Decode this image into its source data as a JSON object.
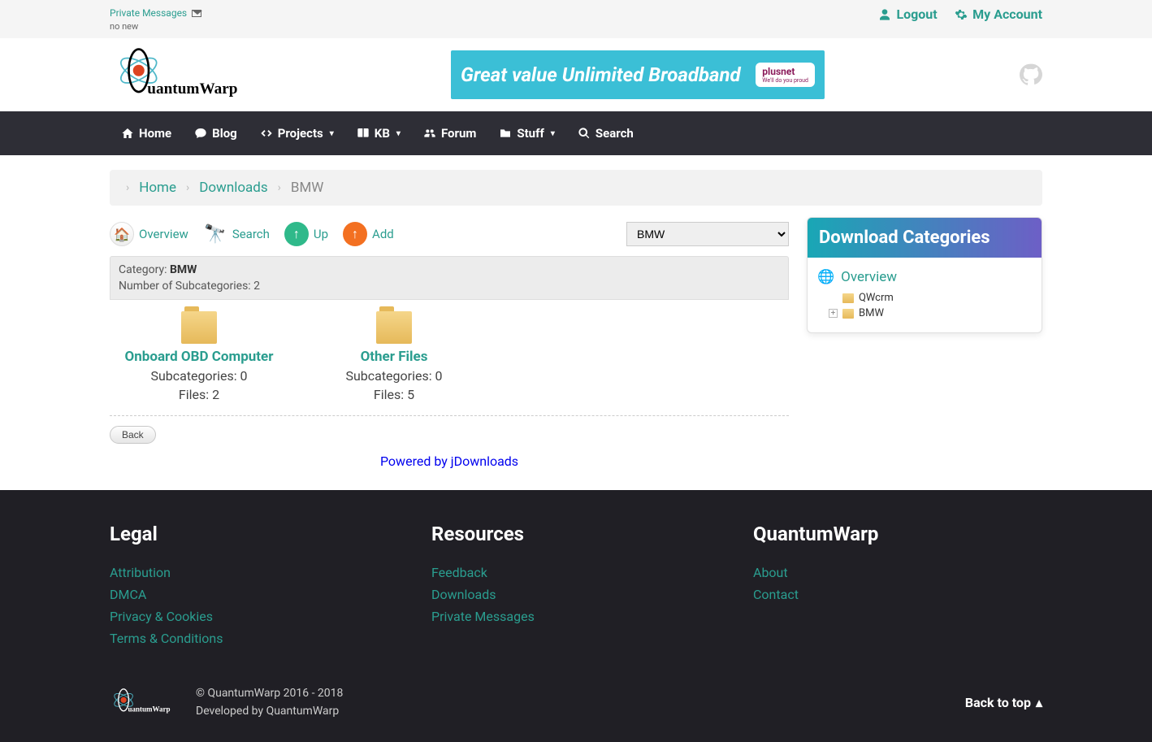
{
  "topbar": {
    "pm_label": "Private Messages",
    "pm_status": "no new",
    "logout": "Logout",
    "account": "My Account"
  },
  "banner": {
    "text": "Great value Unlimited Broadband",
    "brand": "plusnet",
    "tag": "We'll do you proud"
  },
  "nav": {
    "home": "Home",
    "blog": "Blog",
    "projects": "Projects",
    "kb": "KB",
    "forum": "Forum",
    "stuff": "Stuff",
    "search": "Search"
  },
  "breadcrumb": {
    "home": "Home",
    "downloads": "Downloads",
    "current": "BMW"
  },
  "toolbar": {
    "overview": "Overview",
    "search": "Search",
    "up": "Up",
    "add": "Add",
    "selected_category": "BMW"
  },
  "cat_header": {
    "label_prefix": "Category: ",
    "category": "BMW",
    "sub_label": "Number of Subcategories: ",
    "sub_count": "2"
  },
  "folders": [
    {
      "title": "Onboard OBD Computer",
      "sub_label": "Subcategories: ",
      "sub": "0",
      "files_label": "Files: ",
      "files": "2"
    },
    {
      "title": "Other Files",
      "sub_label": "Subcategories: ",
      "sub": "0",
      "files_label": "Files: ",
      "files": "5"
    }
  ],
  "back_label": "Back",
  "powered": "Powered by jDownloads",
  "sidebar": {
    "title": "Download Categories",
    "overview": "Overview",
    "items": [
      {
        "label": "QWcrm",
        "expandable": false
      },
      {
        "label": "BMW",
        "expandable": true
      }
    ]
  },
  "footer": {
    "cols": [
      {
        "title": "Legal",
        "links": [
          "Attribution",
          "DMCA",
          "Privacy & Cookies",
          "Terms & Conditions"
        ]
      },
      {
        "title": "Resources",
        "links": [
          "Feedback",
          "Downloads",
          "Private Messages"
        ]
      },
      {
        "title": "QuantumWarp",
        "links": [
          "About",
          "Contact"
        ]
      }
    ],
    "copyright": "© QuantumWarp 2016 - 2018",
    "developed": "Developed by QuantumWarp",
    "back_top": "Back to top"
  },
  "brand_name": "QuantumWarp"
}
